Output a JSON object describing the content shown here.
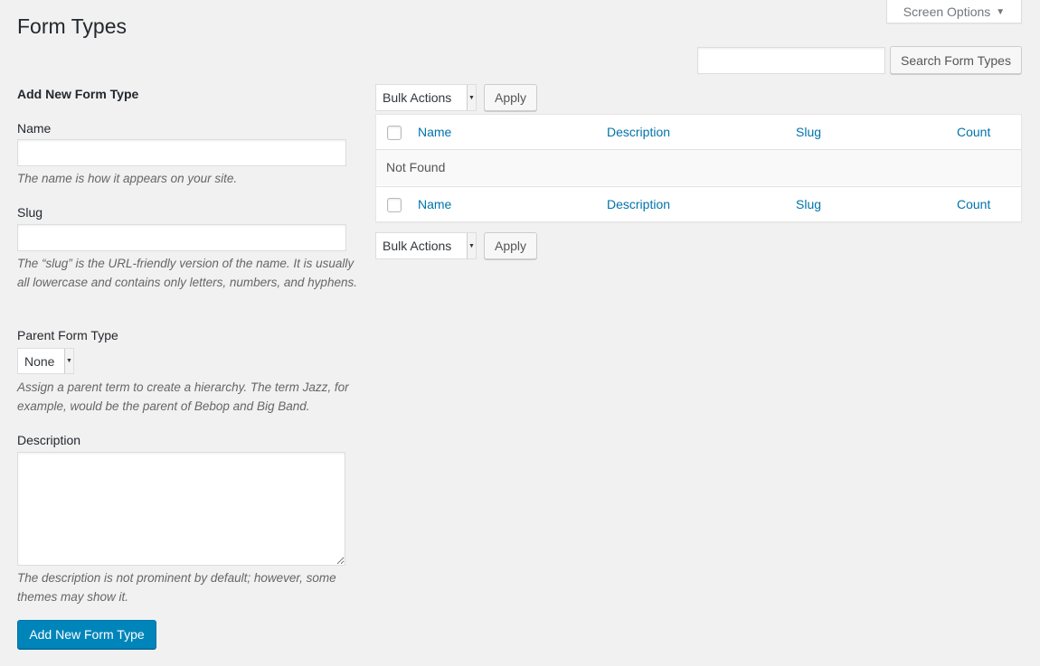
{
  "header": {
    "screen_options_label": "Screen Options",
    "title": "Form Types"
  },
  "search": {
    "value": "",
    "button_label": "Search Form Types"
  },
  "form": {
    "heading": "Add New Form Type",
    "name": {
      "label": "Name",
      "value": "",
      "help": "The name is how it appears on your site."
    },
    "slug": {
      "label": "Slug",
      "value": "",
      "help": "The “slug” is the URL-friendly version of the name. It is usually all lowercase and contains only letters, numbers, and hyphens."
    },
    "parent": {
      "label": "Parent Form Type",
      "selected": "None",
      "help": "Assign a parent term to create a hierarchy. The term Jazz, for example, would be the parent of Bebop and Big Band."
    },
    "description": {
      "label": "Description",
      "value": "",
      "help": "The description is not prominent by default; however, some themes may show it."
    },
    "submit_label": "Add New Form Type"
  },
  "table": {
    "bulk_actions_label": "Bulk Actions",
    "apply_label": "Apply",
    "columns": [
      "Name",
      "Description",
      "Slug",
      "Count"
    ],
    "empty_message": "Not Found"
  },
  "colors": {
    "accent": "#0073aa",
    "primary_button": "#0085ba",
    "background": "#f1f1f1"
  }
}
